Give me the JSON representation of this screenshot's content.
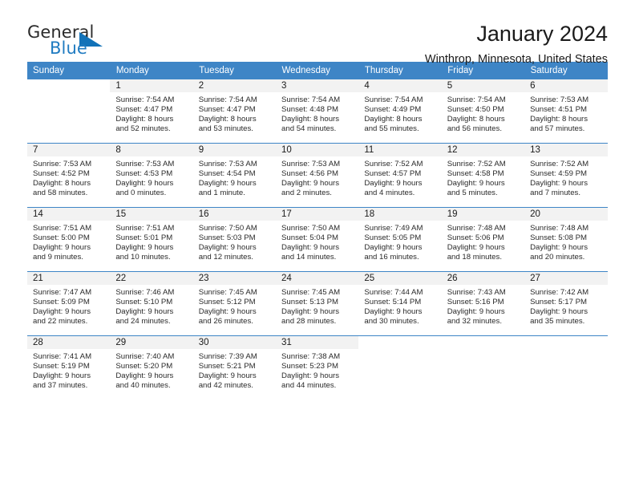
{
  "logo": {
    "primary_text": "General",
    "secondary_text": "Blue",
    "primary_color": "#2b2b2b",
    "secondary_color": "#1f7bc1",
    "triangle_color": "#1272b8"
  },
  "header": {
    "title": "January 2024",
    "location": "Winthrop, Minnesota, United States"
  },
  "theme": {
    "header_row_bg": "#3e85c6",
    "header_row_text": "#ffffff",
    "daynum_bg": "#f2f2f2",
    "body_text": "#2a2a2a"
  },
  "weekday_headers": [
    "Sunday",
    "Monday",
    "Tuesday",
    "Wednesday",
    "Thursday",
    "Friday",
    "Saturday"
  ],
  "weeks": [
    [
      {
        "day": "",
        "sunrise": "",
        "sunset": "",
        "daylight_line1": "",
        "daylight_line2": "",
        "blank": true
      },
      {
        "day": "1",
        "sunrise": "Sunrise: 7:54 AM",
        "sunset": "Sunset: 4:47 PM",
        "daylight_line1": "Daylight: 8 hours",
        "daylight_line2": "and 52 minutes."
      },
      {
        "day": "2",
        "sunrise": "Sunrise: 7:54 AM",
        "sunset": "Sunset: 4:47 PM",
        "daylight_line1": "Daylight: 8 hours",
        "daylight_line2": "and 53 minutes."
      },
      {
        "day": "3",
        "sunrise": "Sunrise: 7:54 AM",
        "sunset": "Sunset: 4:48 PM",
        "daylight_line1": "Daylight: 8 hours",
        "daylight_line2": "and 54 minutes."
      },
      {
        "day": "4",
        "sunrise": "Sunrise: 7:54 AM",
        "sunset": "Sunset: 4:49 PM",
        "daylight_line1": "Daylight: 8 hours",
        "daylight_line2": "and 55 minutes."
      },
      {
        "day": "5",
        "sunrise": "Sunrise: 7:54 AM",
        "sunset": "Sunset: 4:50 PM",
        "daylight_line1": "Daylight: 8 hours",
        "daylight_line2": "and 56 minutes."
      },
      {
        "day": "6",
        "sunrise": "Sunrise: 7:53 AM",
        "sunset": "Sunset: 4:51 PM",
        "daylight_line1": "Daylight: 8 hours",
        "daylight_line2": "and 57 minutes."
      }
    ],
    [
      {
        "day": "7",
        "sunrise": "Sunrise: 7:53 AM",
        "sunset": "Sunset: 4:52 PM",
        "daylight_line1": "Daylight: 8 hours",
        "daylight_line2": "and 58 minutes."
      },
      {
        "day": "8",
        "sunrise": "Sunrise: 7:53 AM",
        "sunset": "Sunset: 4:53 PM",
        "daylight_line1": "Daylight: 9 hours",
        "daylight_line2": "and 0 minutes."
      },
      {
        "day": "9",
        "sunrise": "Sunrise: 7:53 AM",
        "sunset": "Sunset: 4:54 PM",
        "daylight_line1": "Daylight: 9 hours",
        "daylight_line2": "and 1 minute."
      },
      {
        "day": "10",
        "sunrise": "Sunrise: 7:53 AM",
        "sunset": "Sunset: 4:56 PM",
        "daylight_line1": "Daylight: 9 hours",
        "daylight_line2": "and 2 minutes."
      },
      {
        "day": "11",
        "sunrise": "Sunrise: 7:52 AM",
        "sunset": "Sunset: 4:57 PM",
        "daylight_line1": "Daylight: 9 hours",
        "daylight_line2": "and 4 minutes."
      },
      {
        "day": "12",
        "sunrise": "Sunrise: 7:52 AM",
        "sunset": "Sunset: 4:58 PM",
        "daylight_line1": "Daylight: 9 hours",
        "daylight_line2": "and 5 minutes."
      },
      {
        "day": "13",
        "sunrise": "Sunrise: 7:52 AM",
        "sunset": "Sunset: 4:59 PM",
        "daylight_line1": "Daylight: 9 hours",
        "daylight_line2": "and 7 minutes."
      }
    ],
    [
      {
        "day": "14",
        "sunrise": "Sunrise: 7:51 AM",
        "sunset": "Sunset: 5:00 PM",
        "daylight_line1": "Daylight: 9 hours",
        "daylight_line2": "and 9 minutes."
      },
      {
        "day": "15",
        "sunrise": "Sunrise: 7:51 AM",
        "sunset": "Sunset: 5:01 PM",
        "daylight_line1": "Daylight: 9 hours",
        "daylight_line2": "and 10 minutes."
      },
      {
        "day": "16",
        "sunrise": "Sunrise: 7:50 AM",
        "sunset": "Sunset: 5:03 PM",
        "daylight_line1": "Daylight: 9 hours",
        "daylight_line2": "and 12 minutes."
      },
      {
        "day": "17",
        "sunrise": "Sunrise: 7:50 AM",
        "sunset": "Sunset: 5:04 PM",
        "daylight_line1": "Daylight: 9 hours",
        "daylight_line2": "and 14 minutes."
      },
      {
        "day": "18",
        "sunrise": "Sunrise: 7:49 AM",
        "sunset": "Sunset: 5:05 PM",
        "daylight_line1": "Daylight: 9 hours",
        "daylight_line2": "and 16 minutes."
      },
      {
        "day": "19",
        "sunrise": "Sunrise: 7:48 AM",
        "sunset": "Sunset: 5:06 PM",
        "daylight_line1": "Daylight: 9 hours",
        "daylight_line2": "and 18 minutes."
      },
      {
        "day": "20",
        "sunrise": "Sunrise: 7:48 AM",
        "sunset": "Sunset: 5:08 PM",
        "daylight_line1": "Daylight: 9 hours",
        "daylight_line2": "and 20 minutes."
      }
    ],
    [
      {
        "day": "21",
        "sunrise": "Sunrise: 7:47 AM",
        "sunset": "Sunset: 5:09 PM",
        "daylight_line1": "Daylight: 9 hours",
        "daylight_line2": "and 22 minutes."
      },
      {
        "day": "22",
        "sunrise": "Sunrise: 7:46 AM",
        "sunset": "Sunset: 5:10 PM",
        "daylight_line1": "Daylight: 9 hours",
        "daylight_line2": "and 24 minutes."
      },
      {
        "day": "23",
        "sunrise": "Sunrise: 7:45 AM",
        "sunset": "Sunset: 5:12 PM",
        "daylight_line1": "Daylight: 9 hours",
        "daylight_line2": "and 26 minutes."
      },
      {
        "day": "24",
        "sunrise": "Sunrise: 7:45 AM",
        "sunset": "Sunset: 5:13 PM",
        "daylight_line1": "Daylight: 9 hours",
        "daylight_line2": "and 28 minutes."
      },
      {
        "day": "25",
        "sunrise": "Sunrise: 7:44 AM",
        "sunset": "Sunset: 5:14 PM",
        "daylight_line1": "Daylight: 9 hours",
        "daylight_line2": "and 30 minutes."
      },
      {
        "day": "26",
        "sunrise": "Sunrise: 7:43 AM",
        "sunset": "Sunset: 5:16 PM",
        "daylight_line1": "Daylight: 9 hours",
        "daylight_line2": "and 32 minutes."
      },
      {
        "day": "27",
        "sunrise": "Sunrise: 7:42 AM",
        "sunset": "Sunset: 5:17 PM",
        "daylight_line1": "Daylight: 9 hours",
        "daylight_line2": "and 35 minutes."
      }
    ],
    [
      {
        "day": "28",
        "sunrise": "Sunrise: 7:41 AM",
        "sunset": "Sunset: 5:19 PM",
        "daylight_line1": "Daylight: 9 hours",
        "daylight_line2": "and 37 minutes."
      },
      {
        "day": "29",
        "sunrise": "Sunrise: 7:40 AM",
        "sunset": "Sunset: 5:20 PM",
        "daylight_line1": "Daylight: 9 hours",
        "daylight_line2": "and 40 minutes."
      },
      {
        "day": "30",
        "sunrise": "Sunrise: 7:39 AM",
        "sunset": "Sunset: 5:21 PM",
        "daylight_line1": "Daylight: 9 hours",
        "daylight_line2": "and 42 minutes."
      },
      {
        "day": "31",
        "sunrise": "Sunrise: 7:38 AM",
        "sunset": "Sunset: 5:23 PM",
        "daylight_line1": "Daylight: 9 hours",
        "daylight_line2": "and 44 minutes."
      },
      {
        "day": "",
        "sunrise": "",
        "sunset": "",
        "daylight_line1": "",
        "daylight_line2": "",
        "blank": true
      },
      {
        "day": "",
        "sunrise": "",
        "sunset": "",
        "daylight_line1": "",
        "daylight_line2": "",
        "blank": true
      },
      {
        "day": "",
        "sunrise": "",
        "sunset": "",
        "daylight_line1": "",
        "daylight_line2": "",
        "blank": true
      }
    ]
  ]
}
